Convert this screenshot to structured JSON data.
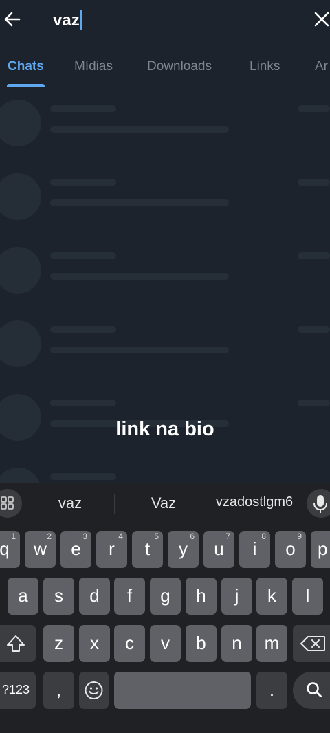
{
  "search": {
    "query": "vaz"
  },
  "tabs": [
    {
      "label": "Chats",
      "active": true
    },
    {
      "label": "Mídias"
    },
    {
      "label": "Downloads"
    },
    {
      "label": "Links"
    },
    {
      "label": "Ar"
    }
  ],
  "overlay_text": "link na bio",
  "keyboard": {
    "suggestions": [
      "vaz",
      "Vaz",
      "vzadostlgm6"
    ],
    "row1": [
      {
        "k": "q",
        "h": "1"
      },
      {
        "k": "w",
        "h": "2"
      },
      {
        "k": "e",
        "h": "3"
      },
      {
        "k": "r",
        "h": "4"
      },
      {
        "k": "t",
        "h": "5"
      },
      {
        "k": "y",
        "h": "6"
      },
      {
        "k": "u",
        "h": "7"
      },
      {
        "k": "i",
        "h": "8"
      },
      {
        "k": "o",
        "h": "9"
      },
      {
        "k": "p",
        "h": "0"
      }
    ],
    "row2": [
      "a",
      "s",
      "d",
      "f",
      "g",
      "h",
      "j",
      "k",
      "l"
    ],
    "row3": [
      "z",
      "x",
      "c",
      "v",
      "b",
      "n",
      "m"
    ],
    "symbols_label": "?123",
    "comma": ",",
    "period": "."
  },
  "colors": {
    "accent": "#5fa8f0",
    "background": "#1c232c",
    "keyboard": "#202124",
    "key": "#5f6167"
  },
  "icons": [
    "back-arrow-icon",
    "close-icon",
    "apps-grid-icon",
    "microphone-icon",
    "shift-icon",
    "backspace-icon",
    "emoji-icon",
    "search-icon"
  ]
}
